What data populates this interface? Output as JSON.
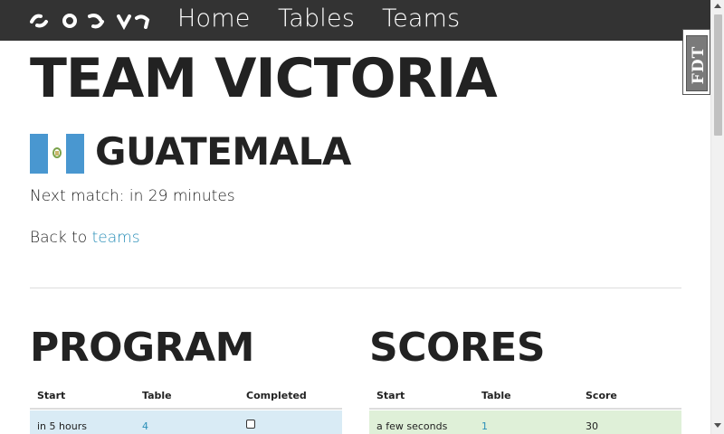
{
  "nav": {
    "logo_alt": "logo",
    "home": "Home",
    "tables": "Tables",
    "teams": "Teams"
  },
  "badge": {
    "text": "FDT"
  },
  "team": {
    "title": "TEAM VICTORIA",
    "country": "GUATEMALA",
    "next_match": "Next match: in 29 minutes",
    "back_prefix": "Back to ",
    "back_link": "teams"
  },
  "program": {
    "title": "PROGRAM",
    "columns": [
      "Start",
      "Table",
      "Completed"
    ],
    "rows": [
      {
        "start": "in 5 hours",
        "table": "4",
        "completed": false
      }
    ]
  },
  "scores": {
    "title": "SCORES",
    "columns": [
      "Start",
      "Table",
      "Score"
    ],
    "rows": [
      {
        "start": "a few seconds",
        "table": "1",
        "score": "30"
      }
    ]
  },
  "colors": {
    "navbar": "#333333",
    "link": "#2a8fb8",
    "program_row": "#d9ebf5",
    "scores_row": "#dff0d8",
    "flag_blue": "#4997d0"
  }
}
